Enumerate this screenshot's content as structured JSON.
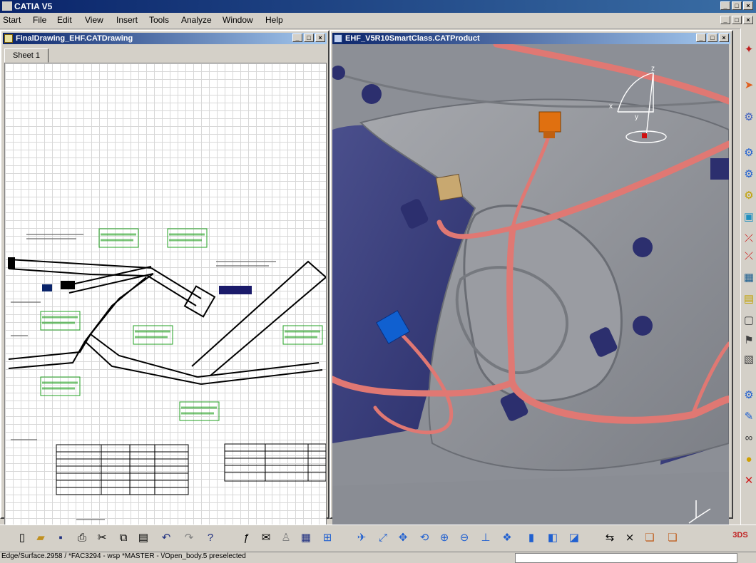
{
  "app": {
    "title": "CATIA V5"
  },
  "menu": [
    "Start",
    "File",
    "Edit",
    "View",
    "Insert",
    "Tools",
    "Analyze",
    "Window",
    "Help"
  ],
  "drawing_window": {
    "title": "FinalDrawing_EHF.CATDrawing",
    "sheet_tab": "Sheet 1"
  },
  "product_window": {
    "title": "EHF_V5R10SmartClass.CATProduct",
    "compass_labels": {
      "x": "x",
      "y": "y",
      "z": "z"
    }
  },
  "status": {
    "text": "Edge/Surface.2958 / *FAC3294 - wsp *MASTER - \\/Open_body.5 preselected",
    "command_value": ""
  },
  "bottom_toolbar_icons": [
    "new-icon",
    "open-icon",
    "save-icon",
    "print-icon",
    "cut-icon",
    "copy-icon",
    "paste-icon",
    "undo-icon",
    "redo-icon",
    "whats-this-icon",
    "formula-icon",
    "comment-icon",
    "knowledge-icon",
    "measure-icon",
    "tree-icon",
    "fly-icon",
    "fit-all-icon",
    "pan-icon",
    "rotate-icon",
    "zoom-in-icon",
    "zoom-out-icon",
    "normal-view-icon",
    "multi-view-icon",
    "view-cube-icon",
    "render-style-icon",
    "hide-show-icon",
    "swap-space-icon",
    "snap-icon",
    "select-icon",
    "catalog-icon",
    "3ds-catia-logo"
  ],
  "right_toolbar_icons": [
    "select-icon",
    "harness-icon",
    "bundle-icon",
    "route-icon",
    "branch-icon",
    "connector-icon",
    "protection-icon",
    "tape-icon",
    "flex-icon",
    "local-slack-icon",
    "analysis-icon",
    "fit-icon",
    "bulb-icon",
    "cancel-icon"
  ],
  "colors": {
    "title_active": "#0a246a",
    "harness": "#e07873",
    "panel": "#8a8d94",
    "annotation_green": "#22a020",
    "connector_orange": "#e07010",
    "connector_blue": "#1060d0"
  }
}
